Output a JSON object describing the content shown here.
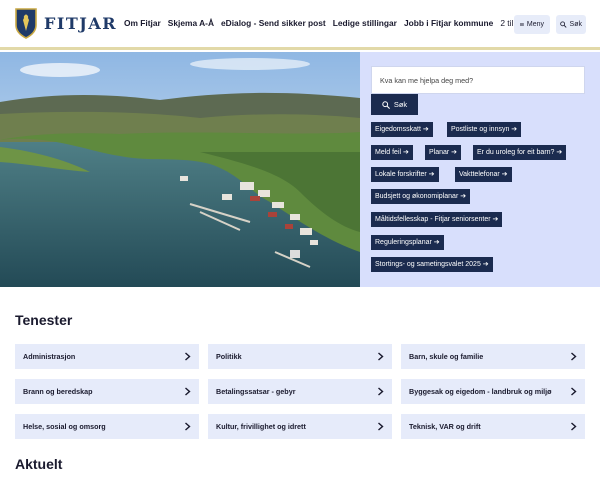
{
  "header": {
    "logo_text": "FITJAR",
    "nav": [
      "Om Fitjar",
      "Skjema A-Å",
      "eDialog - Send sikker post",
      "Ledige stillingar",
      "Jobb i Fitjar kommune"
    ],
    "nav_more": "2 til",
    "menu_label": "Meny",
    "search_label": "Søk"
  },
  "hero": {
    "search_placeholder": "Kva kan me hjelpa deg med?",
    "search_button": "Søk",
    "quicklinks": [
      "Eigedomsskatt ➔",
      "Postliste og innsyn ➔",
      "Meld feil ➔",
      "Planar ➔",
      "Er du uroleg for eit barn? ➔",
      "Lokale forskrifter ➔",
      "Vakttelefonar ➔",
      "Budsjett og økonomiplanar ➔",
      "Måltidsfellesskap - Fitjar seniorsenter ➔",
      "Reguleringsplanar ➔",
      "Stortings- og sametingsvalet 2025 ➔"
    ]
  },
  "tenester": {
    "title": "Tenester",
    "items": [
      "Administrasjon",
      "Politikk",
      "Barn, skule og familie",
      "Brann og beredskap",
      "Betalingssatsar - gebyr",
      "Byggesak og eigedom - landbruk og miljø",
      "Helse, sosial og omsorg",
      "Kultur, frivillighet og idrett",
      "Teknisk, VAR og drift"
    ]
  },
  "aktuelt": {
    "title": "Aktuelt"
  },
  "colors": {
    "navy": "#1b2b4f",
    "panel": "#d8dffc",
    "tile": "#e6ebfa",
    "accent_line": "#e2d9a8"
  }
}
